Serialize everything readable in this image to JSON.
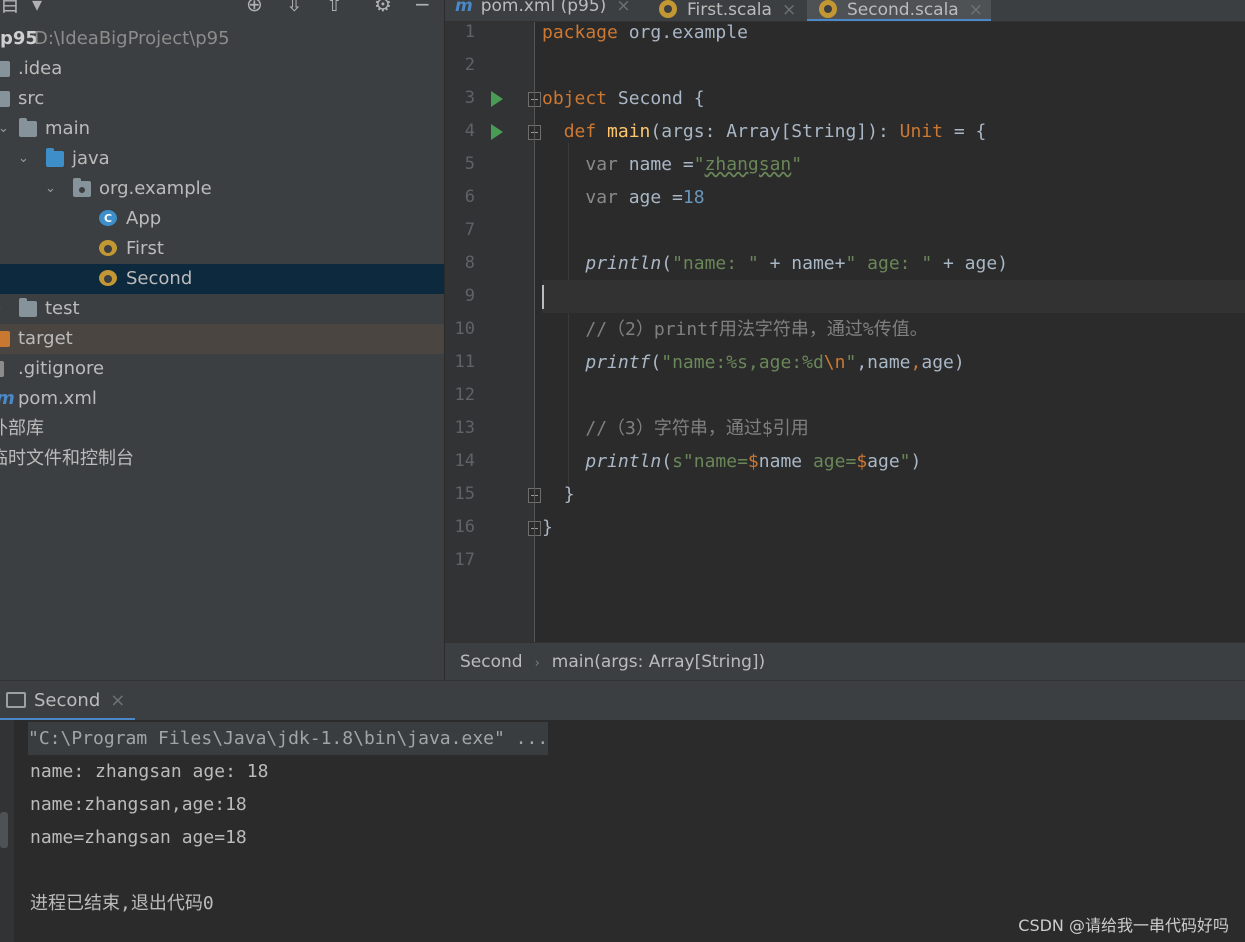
{
  "project": {
    "name": "p95",
    "path": "D:\\IdeaBigProject\\p95",
    "items": [
      {
        "label": ".idea"
      },
      {
        "label": "src"
      },
      {
        "label": "main"
      },
      {
        "label": "java"
      },
      {
        "label": "org.example"
      },
      {
        "label": "App"
      },
      {
        "label": "First"
      },
      {
        "label": "Second"
      },
      {
        "label": "test"
      },
      {
        "label": "target"
      },
      {
        "label": ".gitignore"
      },
      {
        "label": "pom.xml"
      },
      {
        "label": "外部库"
      },
      {
        "label": "临时文件和控制台"
      }
    ]
  },
  "editor_tabs": [
    {
      "label": "pom.xml (p95)"
    },
    {
      "label": "First.scala"
    },
    {
      "label": "Second.scala",
      "active": true
    }
  ],
  "code": {
    "line_numbers": [
      "1",
      "2",
      "3",
      "4",
      "5",
      "6",
      "7",
      "8",
      "9",
      "10",
      "11",
      "12",
      "13",
      "14",
      "15",
      "16",
      "17"
    ],
    "l1": {
      "kw": "package",
      "rest": " org.example"
    },
    "l3": {
      "kw": "object",
      "name": " Second {"
    },
    "l4": {
      "kw": "def",
      "fn": "main",
      "p1": "(args: Array[String]): ",
      "type": "Unit",
      "p2": " = {"
    },
    "l5": {
      "kw": "var",
      "p1": " name =",
      "q1": "\"",
      "typo": "zhangsan",
      "q2": "\""
    },
    "l6": {
      "kw": "var",
      "p1": " age =",
      "num": "18"
    },
    "l8": {
      "fn": "println",
      "p1": "(",
      "s1": "\"name: \"",
      "p2": " + name+",
      "s2": "\" age: \"",
      "p3": " + age)"
    },
    "l10": {
      "comment": "//（2）printf用法字符串，通过%传值。"
    },
    "l11": {
      "fn": "printf",
      "p1": "(",
      "s1": "\"name:%s,age:%d",
      "esc": "\\n",
      "s2": "\"",
      "p2": ",name",
      "comma": ",",
      "p3": "age)"
    },
    "l13": {
      "comment": "//（3）字符串，通过$引用"
    },
    "l14": {
      "fn": "println",
      "p1": "(",
      "s1": "s\"name=",
      "d1": "$",
      "v1": "name",
      "s2": " age=",
      "d2": "$",
      "v2": "age",
      "s3": "\"",
      "p2": ")"
    },
    "l15": {
      "text": "}"
    },
    "l16": {
      "text": "}"
    }
  },
  "breadcrumb": {
    "item1": "Second",
    "separator": "›",
    "item2": "main(args: Array[String])"
  },
  "run": {
    "tab_label": "Second",
    "close": "×",
    "lines": [
      "\"C:\\Program Files\\Java\\jdk-1.8\\bin\\java.exe\" ...",
      "name: zhangsan age: 18",
      "name:zhangsan,age:18",
      "name=zhangsan age=18",
      "进程已结束,退出代码0"
    ]
  },
  "watermark": "CSDN @请给我一串代码好吗",
  "close_glyph": "×",
  "colors": {
    "accent": "#4a88c7",
    "keyword": "#cc7832",
    "string": "#6a8759",
    "number": "#6897bb",
    "function": "#ffc66d"
  }
}
